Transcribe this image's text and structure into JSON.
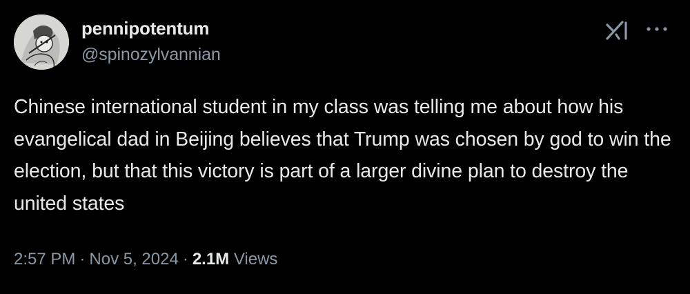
{
  "author": {
    "display_name": "pennipotentum",
    "handle": "@spinozylvannian",
    "avatar_icon": "avatar-illustration-icon"
  },
  "tweet": {
    "text": "Chinese international student in my class was telling me about how his evangelical dad in Beijing believes that Trump was chosen by god to win the election, but that this victory is part of a larger divine plan to destroy the united states"
  },
  "meta": {
    "time": "2:57 PM",
    "separator": "·",
    "date": "Nov 5, 2024",
    "views_count": "2.1M",
    "views_label": "Views"
  },
  "icons": {
    "grok": "grok-icon",
    "more": "more-icon"
  },
  "colors": {
    "background": "#000000",
    "primary_text": "#e7e9ea",
    "secondary_text": "#8b98a5"
  }
}
